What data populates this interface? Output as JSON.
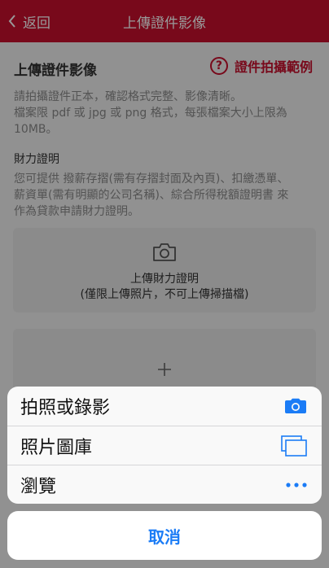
{
  "nav": {
    "back_label": "返回",
    "title": "上傳證件影像"
  },
  "page": {
    "heading": "上傳證件影像",
    "example_link": "證件拍攝範例",
    "instructions": [
      "請拍攝證件正本，確認格式完整、影像清晰。",
      "檔案限 pdf 或 jpg 或 png 格式，每張檔案大小上限為",
      "10MB。"
    ],
    "financial": {
      "heading": "財力證明",
      "description": [
        "您可提供 撥薪存摺(需有存摺封面及內頁)、扣繳憑單、",
        "薪資單(需有明顯的公司名稱)、綜合所得稅額證明書 來",
        "作為貸款申請財力證明。"
      ],
      "upload_label": "上傳財力證明",
      "upload_note": "(僅限上傳照片，不可上傳掃描檔)"
    }
  },
  "action_sheet": {
    "options": [
      {
        "label": "拍照或錄影",
        "icon": "camera-icon"
      },
      {
        "label": "照片圖庫",
        "icon": "photo-library-icon"
      },
      {
        "label": "瀏覽",
        "icon": "more-icon"
      }
    ],
    "cancel_label": "取消"
  },
  "colors": {
    "brand": "#c8102e",
    "ios_blue": "#1b7cf6"
  }
}
